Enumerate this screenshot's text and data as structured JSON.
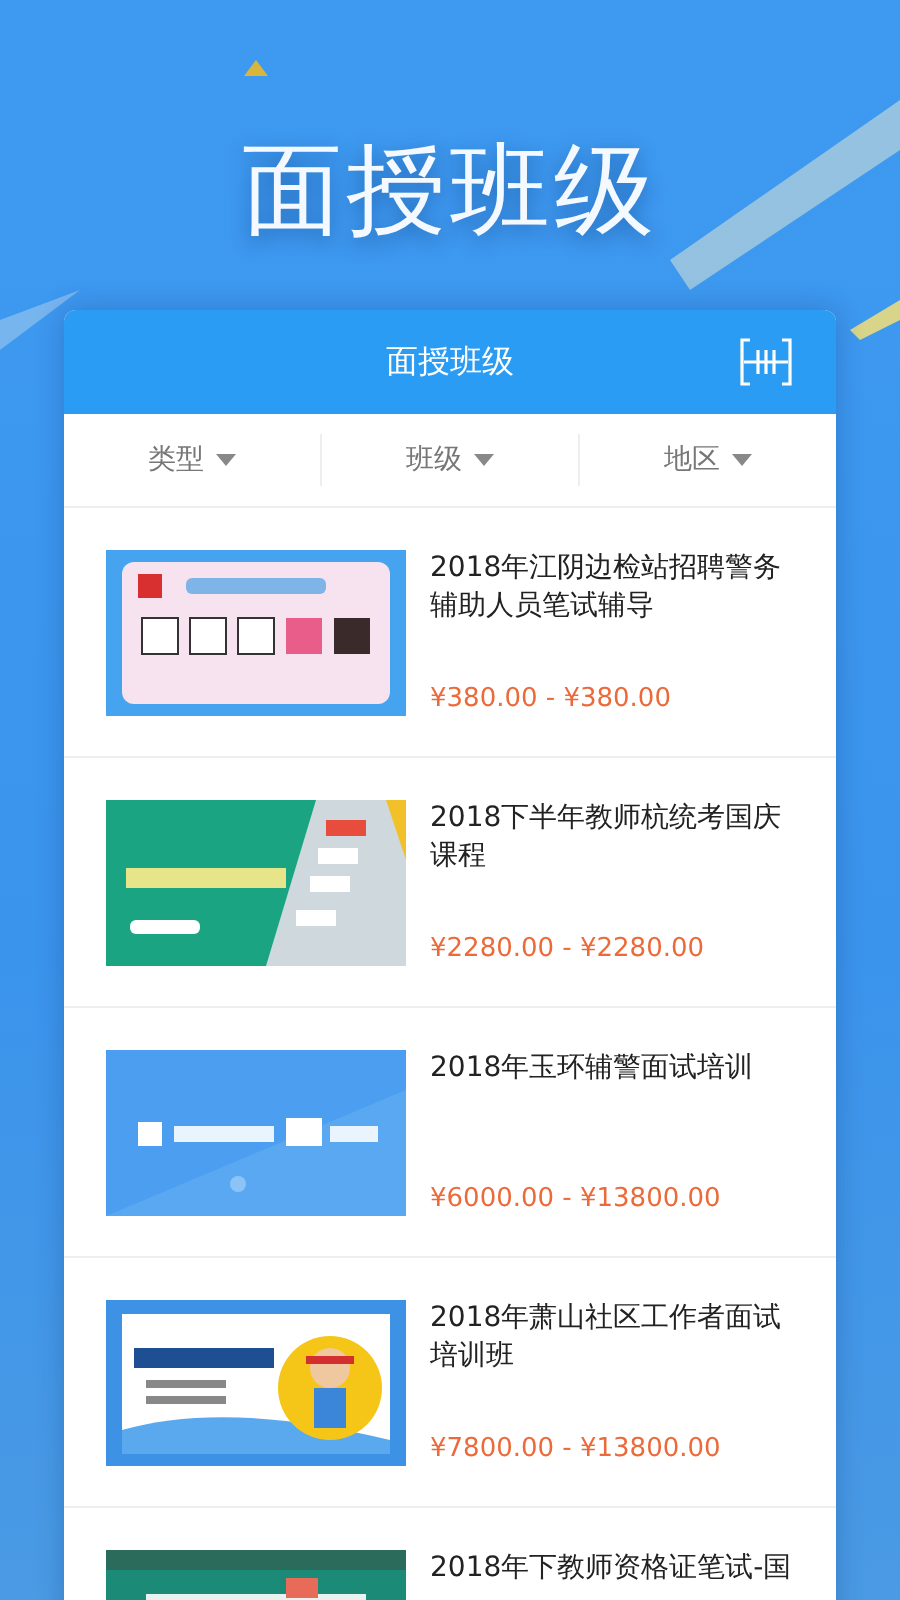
{
  "banner": {
    "title": "面授班级"
  },
  "card": {
    "title": "面授班级"
  },
  "filters": [
    {
      "label": "类型"
    },
    {
      "label": "班级"
    },
    {
      "label": "地区"
    }
  ],
  "courses": [
    {
      "title": "2018年江阴边检站招聘警务辅助人员笔试辅导",
      "price": "¥380.00 - ¥380.00"
    },
    {
      "title": "2018下半年教师杭统考国庆课程",
      "price": "¥2280.00 - ¥2280.00"
    },
    {
      "title": "2018年玉环辅警面试培训",
      "price": "¥6000.00 - ¥13800.00"
    },
    {
      "title": "2018年萧山社区工作者面试培训班",
      "price": "¥7800.00 - ¥13800.00"
    },
    {
      "title": "2018年下教师资格证笔试-国"
    }
  ]
}
